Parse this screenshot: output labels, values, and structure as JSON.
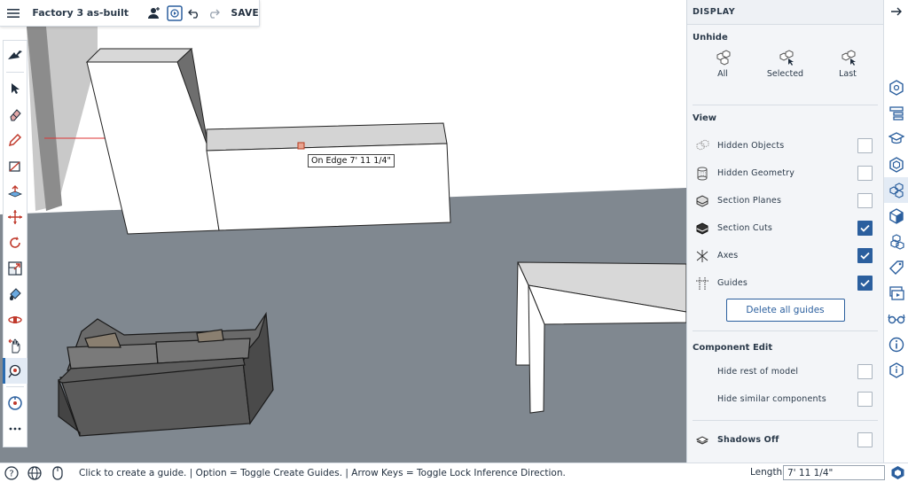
{
  "app": {
    "document_title": "Factory 3 as-built",
    "save_label": "SAVE"
  },
  "viewport": {
    "inference_tooltip": "On Edge 7' 11 1/4\""
  },
  "toolbar": {
    "tools": [
      "select-icon",
      "eraser-icon",
      "pencil-icon",
      "rectangle-icon",
      "push-pull-icon",
      "move-icon",
      "rotate-icon",
      "scale-icon",
      "paint-bucket-icon",
      "orbit-icon",
      "pan-icon",
      "tape-measure-icon",
      "search-tools-icon",
      "more-icon"
    ],
    "active_tool": "tape-measure-icon"
  },
  "panel": {
    "header": "DISPLAY",
    "unhide": {
      "title": "Unhide",
      "buttons": [
        {
          "label": "All"
        },
        {
          "label": "Selected"
        },
        {
          "label": "Last"
        }
      ]
    },
    "view": {
      "title": "View",
      "items": [
        {
          "label": "Hidden Objects",
          "checked": false
        },
        {
          "label": "Hidden Geometry",
          "checked": false
        },
        {
          "label": "Section Planes",
          "checked": false
        },
        {
          "label": "Section Cuts",
          "checked": true
        },
        {
          "label": "Axes",
          "checked": true
        },
        {
          "label": "Guides",
          "checked": true
        }
      ],
      "delete_guides_label": "Delete all guides"
    },
    "component_edit": {
      "title": "Component Edit",
      "items": [
        {
          "label": "Hide rest of model",
          "checked": false
        },
        {
          "label": "Hide similar components",
          "checked": false
        }
      ]
    },
    "shadows": {
      "label": "Shadows Off",
      "checked": false
    }
  },
  "statusbar": {
    "text": "Click to create a guide. | Option = Toggle Create Guides. | Arrow Keys = Toggle Lock Inference Direction.",
    "length_label": "Length",
    "length_value": "7' 11 1/4\""
  },
  "colors": {
    "accent": "#2b5f9e",
    "ground": "#808890",
    "sky": "#ffffff"
  }
}
